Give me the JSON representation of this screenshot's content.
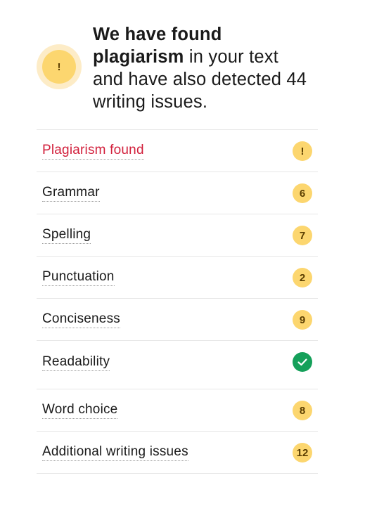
{
  "summary": {
    "alert_symbol": "!",
    "headline_bold_1": "We have found",
    "headline_bold_2": "plagiarism",
    "headline_rest": " in your text and have also detected 44 writing issues."
  },
  "issues": [
    {
      "label": "Plagiarism found",
      "badge": "!",
      "state": "alert"
    },
    {
      "label": "Grammar",
      "badge": "6",
      "state": "count"
    },
    {
      "label": "Spelling",
      "badge": "7",
      "state": "count"
    },
    {
      "label": "Punctuation",
      "badge": "2",
      "state": "count"
    },
    {
      "label": "Conciseness",
      "badge": "9",
      "state": "count"
    },
    {
      "label": "Readability",
      "badge": "",
      "state": "ok"
    },
    {
      "label": "Word choice",
      "badge": "8",
      "state": "count"
    },
    {
      "label": "Additional writing issues",
      "badge": "12",
      "state": "count"
    }
  ],
  "colors": {
    "accent_yellow": "#fcd66f",
    "alert_red": "#d2203c",
    "ok_green": "#15a05a"
  }
}
